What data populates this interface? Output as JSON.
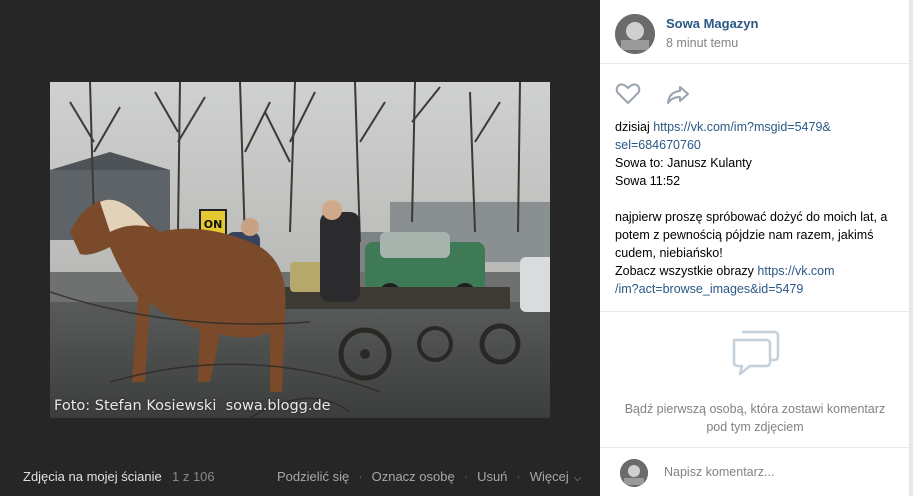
{
  "photo": {
    "caption_credit": "Foto: Stefan Kosiewski  sowa.blogg.de",
    "sign_text": "ON"
  },
  "bottom_bar": {
    "album": "Zdjęcia na mojej ścianie",
    "counter": "1 z 106",
    "actions": {
      "share": "Podzielić się",
      "tag": "Oznacz osobę",
      "delete": "Usuń",
      "more": "Więcej"
    },
    "separator": "·"
  },
  "post": {
    "author": "Sowa Magazyn",
    "time": "8 minut temu",
    "line1_prefix": "dzisiaj ",
    "line1_link": "https://vk.com/im?msgid=5479&sel=684670760",
    "line1_link_a": "https://vk.com/im?msgid=5479&",
    "line1_link_b": "sel=684670760",
    "line2": "Sowa to: Janusz Kulanty",
    "line3": "Sowa 11:52",
    "paragraph": "najpierw proszę spróbować dożyć do moich lat, a potem z pewnością pójdzie nam razem, jakimś cudem, niebiańsko!",
    "see_all_prefix": "Zobacz wszystkie obrazy ",
    "see_all_link_a": "https://vk.com",
    "see_all_link_b": "/im?act=browse_images&id=5479"
  },
  "comments": {
    "empty_text": "Bądź pierwszą osobą, która zostawi komentarz pod tym zdjęciem",
    "input_placeholder": "Napisz komentarz..."
  },
  "icons": [
    "heart-icon",
    "share-arrow-icon",
    "speech-bubbles-icon",
    "chevron-down-icon"
  ],
  "colors": {
    "link": "#2a5885",
    "muted": "#828282",
    "dark_bg": "#262626",
    "panel_bg": "#ffffff"
  }
}
